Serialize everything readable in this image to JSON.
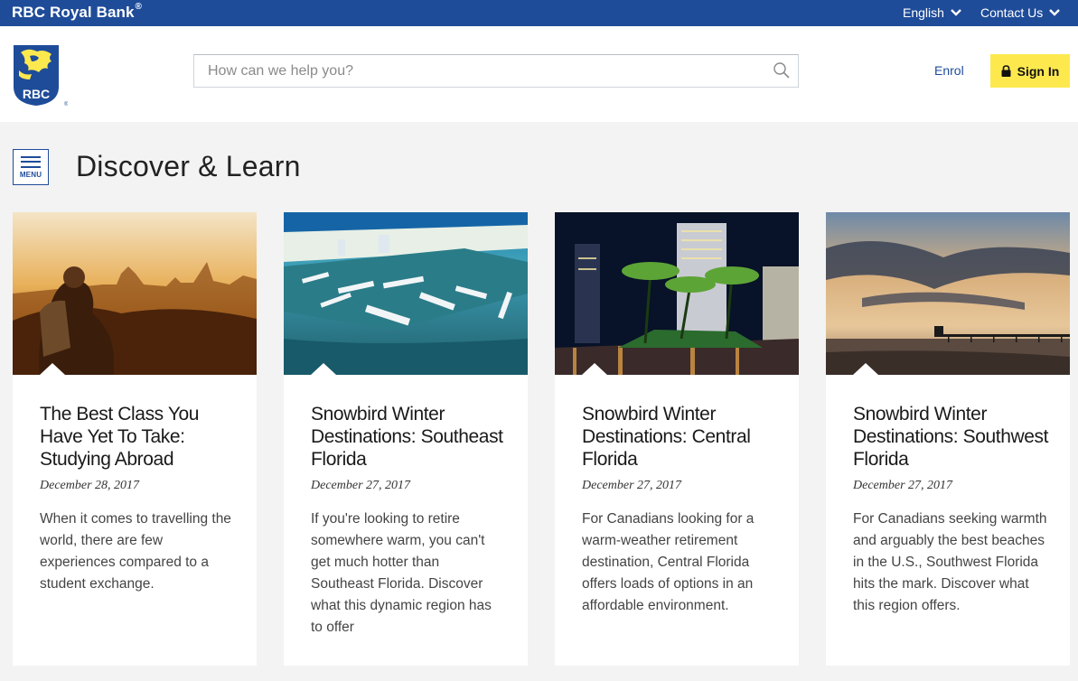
{
  "topbar": {
    "brand": "RBC Royal Bank",
    "brand_mark": "®",
    "language": "English",
    "contact": "Contact Us"
  },
  "header": {
    "logo_text": "RBC",
    "search_placeholder": "How can we help you?",
    "enrol": "Enrol",
    "signin": "Sign In"
  },
  "menu": {
    "label": "MENU"
  },
  "page": {
    "title": "Discover & Learn"
  },
  "colors": {
    "brand_blue": "#1f4c99",
    "signin_yellow": "#fde94e"
  },
  "cards": [
    {
      "title": "The Best Class You Have Yet To Take: Studying Abroad",
      "date": "December 28, 2017",
      "description": "When it comes to travelling the world, there are few experiences compared to a student exchange."
    },
    {
      "title": "Snowbird Winter Destinations: Southeast Florida",
      "date": "December 27, 2017",
      "description": "If you're looking to retire somewhere warm, you can't get much hotter than Southeast Florida. Discover what this dynamic region has to offer"
    },
    {
      "title": "Snowbird Winter Destinations: Central Florida",
      "date": "December 27, 2017",
      "description": "For Canadians looking for a warm-weather retirement destination, Central Florida offers loads of options in an affordable environment."
    },
    {
      "title": "Snowbird Winter Destinations: Southwest Florida",
      "date": "December 27, 2017",
      "description": "For Canadians seeking warmth and arguably the best beaches in the U.S., Southwest Florida hits the mark. Discover what this region offers."
    }
  ]
}
